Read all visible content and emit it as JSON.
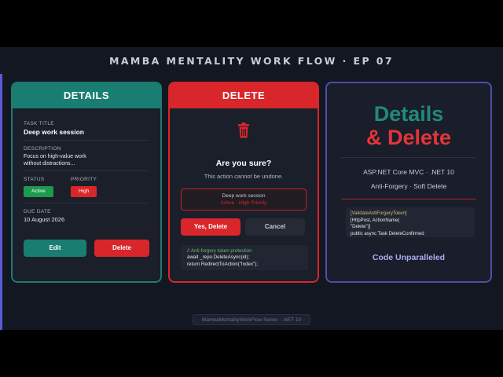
{
  "header": {
    "title": "MAMBA MENTALITY WORK FLOW · EP 07"
  },
  "details_card": {
    "title": "DETAILS",
    "task_title_label": "TASK TITLE",
    "task_title": "Deep work session",
    "description_label": "DESCRIPTION",
    "description_line1": "Focus on high-value work",
    "description_line2": "without distractions...",
    "status_label": "STATUS",
    "status_value": "Active",
    "priority_label": "PRIORITY",
    "priority_value": "High",
    "due_date_label": "DUE DATE",
    "due_date": "10 August 2026",
    "edit_label": "Edit",
    "delete_label": "Delete"
  },
  "delete_card": {
    "title": "DELETE",
    "icon": "trash-icon",
    "question": "Are you sure?",
    "warning": "This action cannot be undone.",
    "item_title": "Deep work session",
    "item_meta": "Active · High Priority",
    "confirm_label": "Yes, Delete",
    "cancel_label": "Cancel",
    "code_line1": "// Anti-forgery token protection",
    "code_line2": "await _repo.DeleteAsync(id);",
    "code_line3": "return RedirectToAction(\"Index\");"
  },
  "info_card": {
    "title_line1": "Details",
    "title_line2": "& Delete",
    "subtitle1": "ASP.NET Core MVC · .NET 10",
    "subtitle2": "Anti-Forgery · Soft Delete",
    "code_line1": "[ValidateAntiForgeryToken]",
    "code_line2": "[HttpPost, ActionName(",
    "code_line3": "\"Delete\")]",
    "code_line4": "public async Task DeleteConfirmed",
    "tagline": "Code Unparalleled"
  },
  "footer": {
    "badge": "MambaMentalityWorkFlow Series · .NET 10"
  },
  "colors": {
    "teal": "#1a7d72",
    "red": "#d9262b",
    "indigo": "#4a4fa8",
    "background": "#131722"
  }
}
